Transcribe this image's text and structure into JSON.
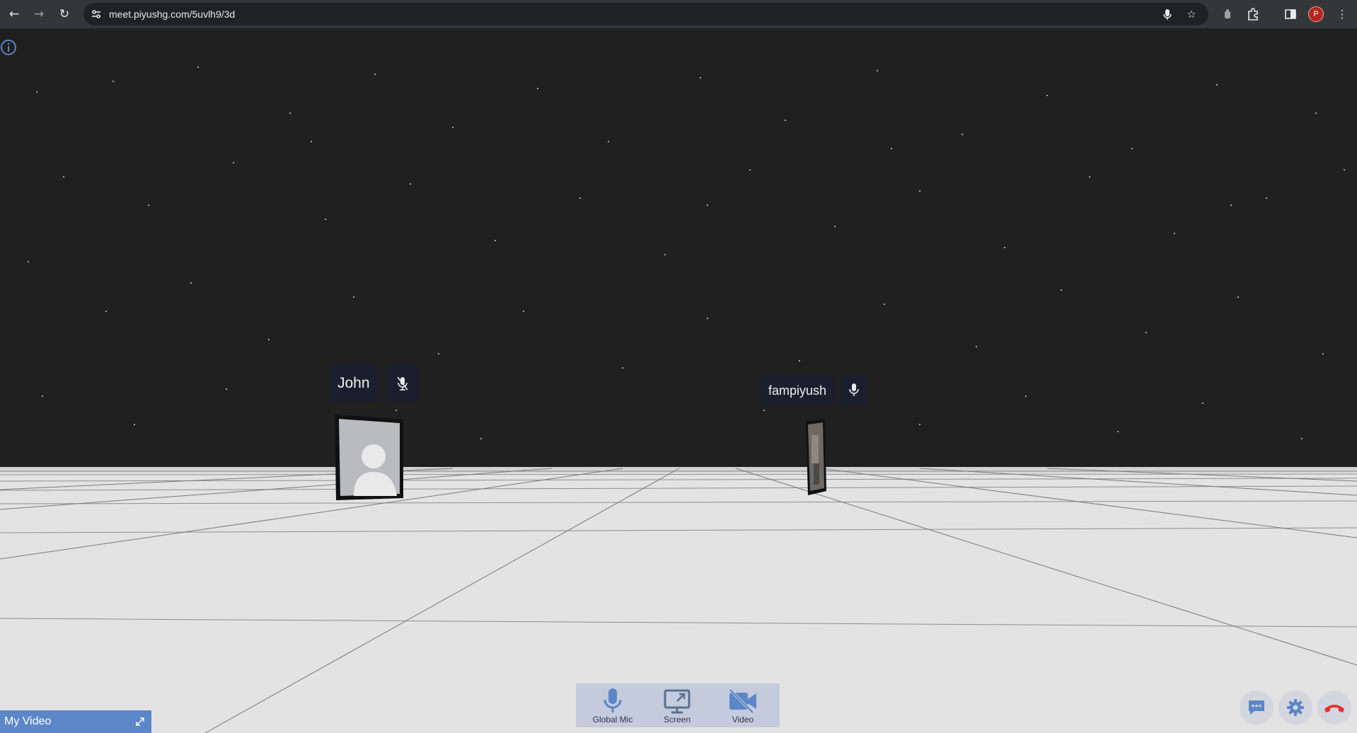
{
  "browser": {
    "url": "meet.piyushg.com/5uvlh9/3d",
    "profile_initial": "P"
  },
  "participants": [
    {
      "name": "John",
      "mic": "muted"
    },
    {
      "name": "fampiyush",
      "mic": "on"
    }
  ],
  "controls": {
    "global_mic_label": "Global Mic",
    "screen_label": "Screen",
    "video_label": "Video"
  },
  "my_video": {
    "label": "My Video"
  },
  "colors": {
    "sky": "#202020",
    "floor": "#e3e3e3",
    "accent": "#5b86c7",
    "control_bar": "#c3cbdc",
    "hangup": "#e0342f"
  },
  "icons": {
    "info": "info-icon",
    "chat": "chat-icon",
    "settings": "gear-icon",
    "hangup": "phone-hangup-icon"
  }
}
